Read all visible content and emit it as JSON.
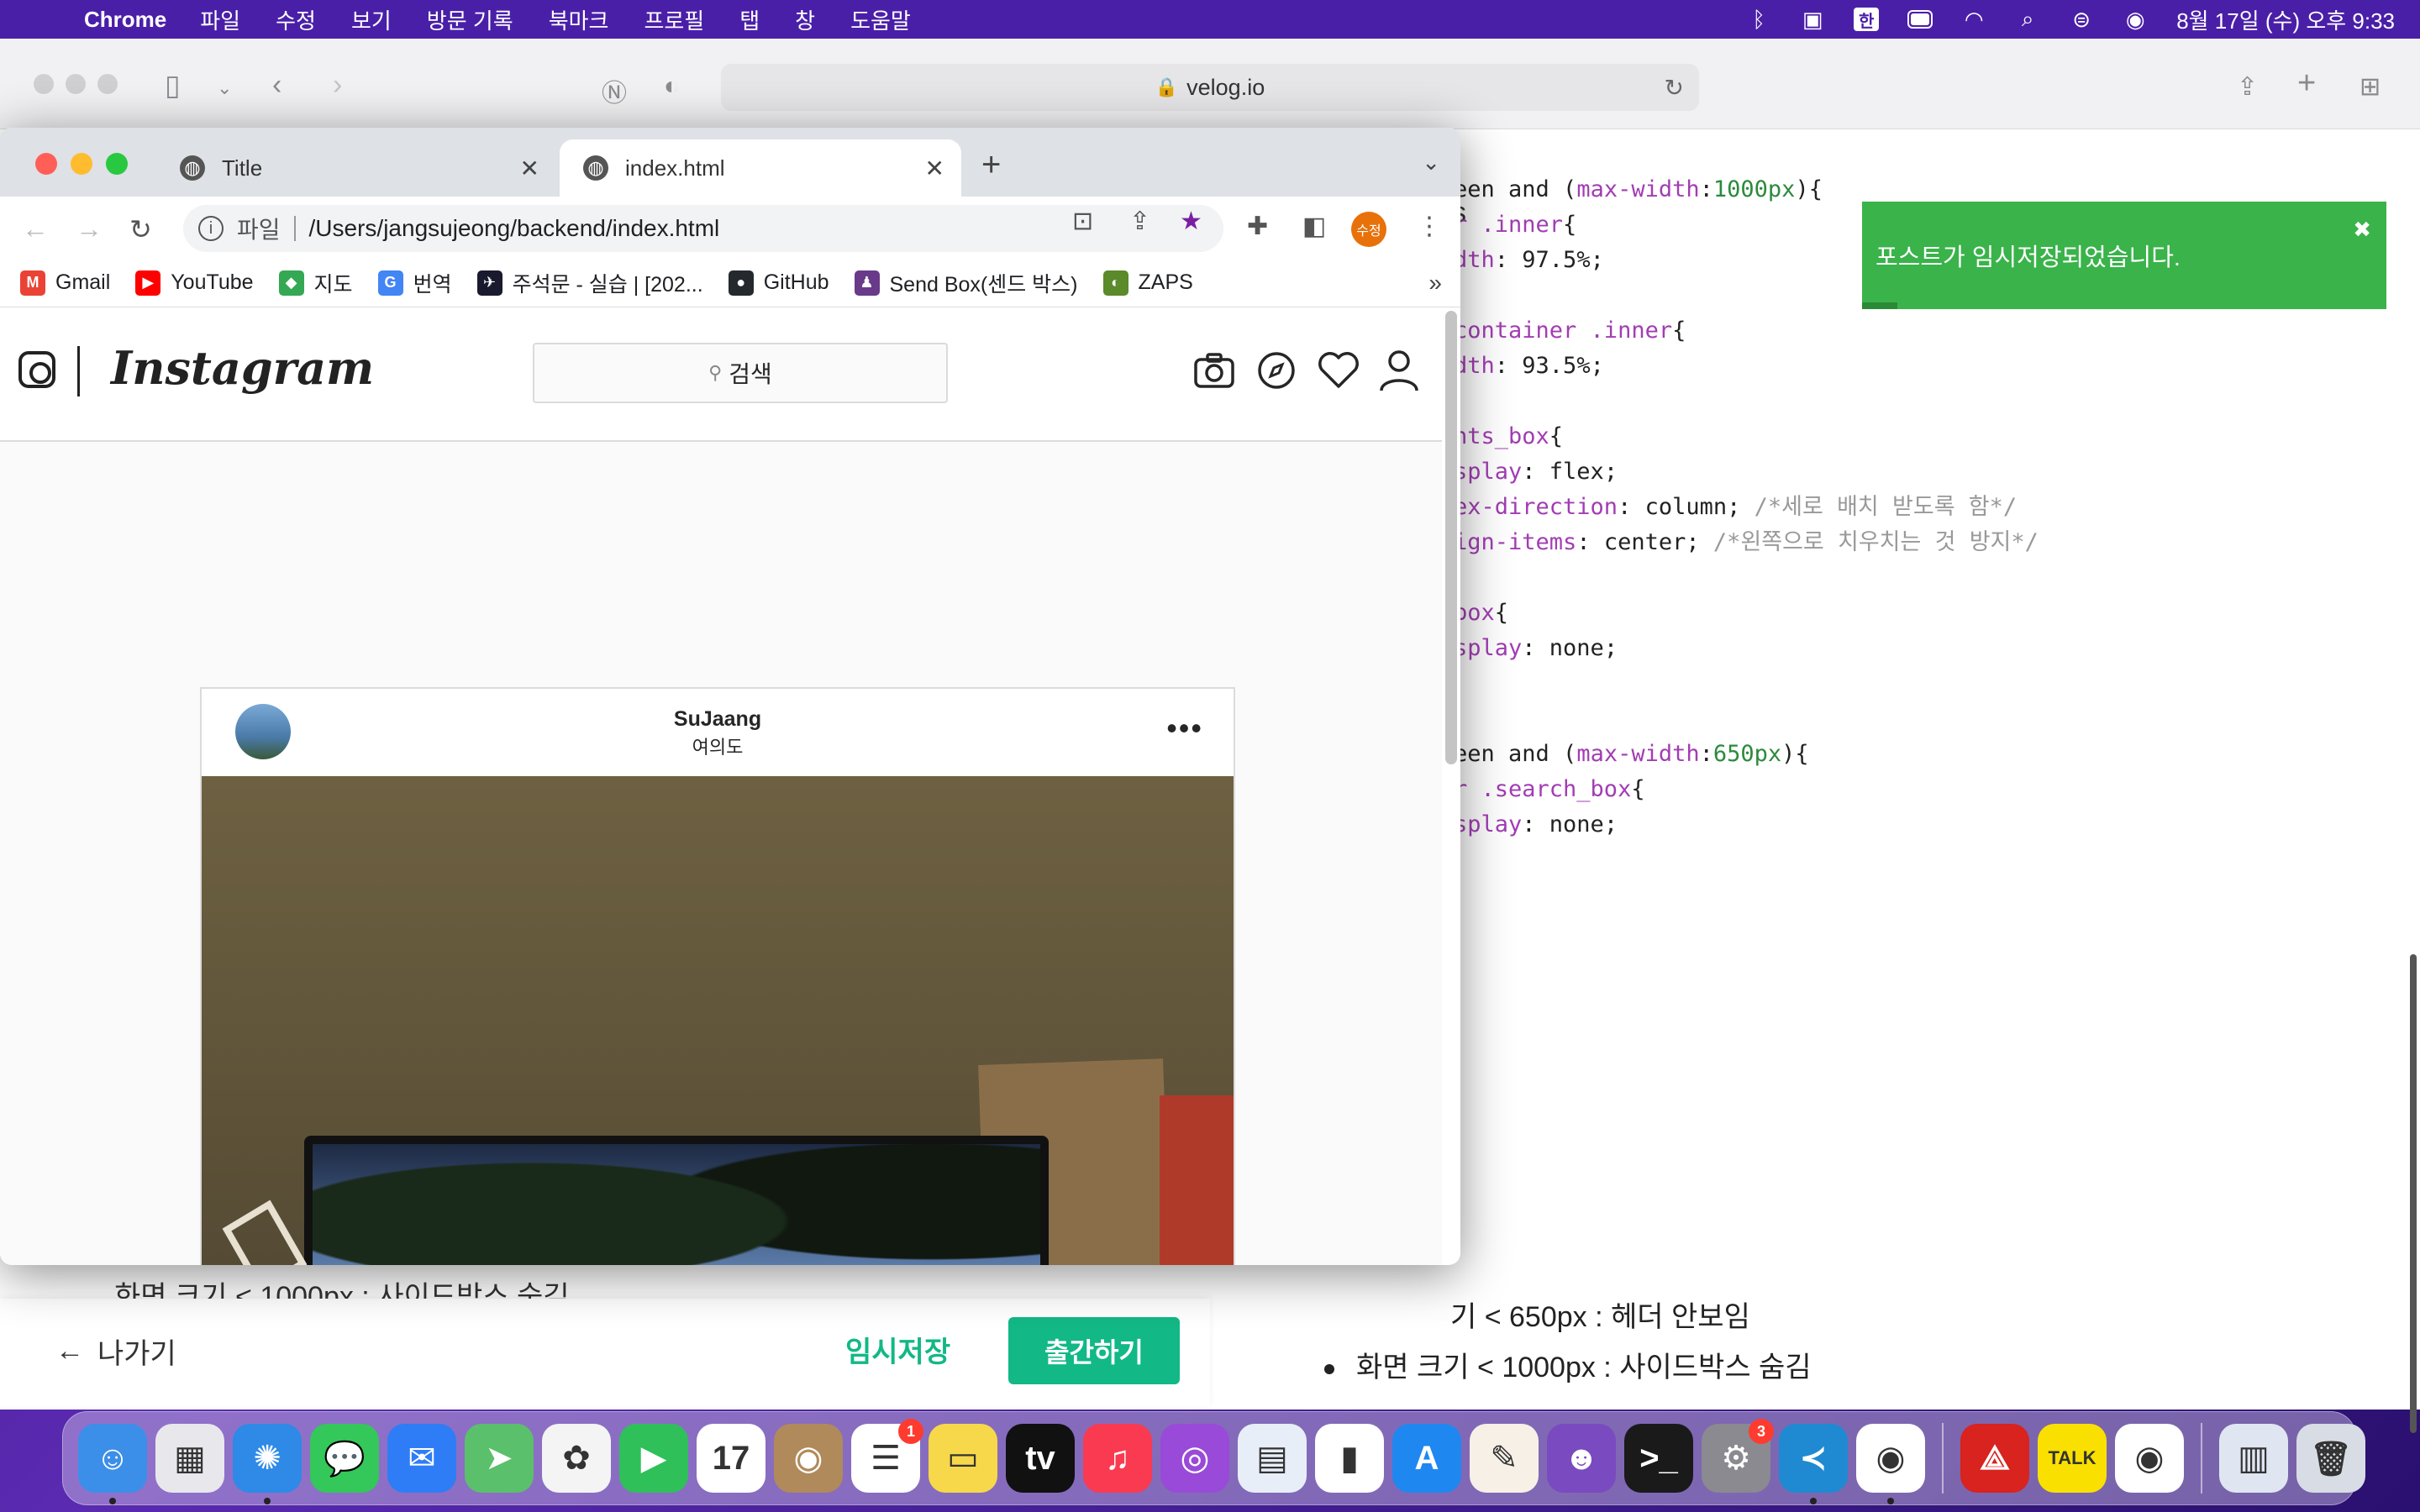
{
  "menubar": {
    "app_name": "Chrome",
    "menus": [
      "파일",
      "수정",
      "보기",
      "방문 기록",
      "북마크",
      "프로필",
      "탭",
      "창",
      "도움말"
    ],
    "ime_label": "한",
    "clock": "8월 17일 (수) 오후 9:33"
  },
  "safari": {
    "address": "velog.io",
    "section_letter": "s",
    "code_lines": [
      {
        "pre": "een and (",
        "kw": "max-width",
        "mid": ":",
        "num": "1000px",
        "post": "){",
        "cmt": ""
      },
      {
        "pre": "",
        "kw": "r .inner",
        "mid": "{",
        "num": "",
        "post": "",
        "cmt": ""
      },
      {
        "pre": "",
        "kw": "dth",
        "mid": ": 97.5%;",
        "num": "",
        "post": "",
        "cmt": ""
      },
      {
        "pre": "",
        "kw": "container .inner",
        "mid": "{",
        "num": "",
        "post": "",
        "cmt": ""
      },
      {
        "pre": "",
        "kw": "dth",
        "mid": ": 93.5%;",
        "num": "",
        "post": "",
        "cmt": ""
      },
      {
        "pre": "",
        "kw": "nts_box",
        "mid": "{",
        "num": "",
        "post": "",
        "cmt": ""
      },
      {
        "pre": "",
        "kw": "splay",
        "mid": ": flex;",
        "num": "",
        "post": "",
        "cmt": ""
      },
      {
        "pre": "",
        "kw": "ex-direction",
        "mid": ": column; ",
        "num": "",
        "post": "",
        "cmt": "/*세로 배치 받도록 함*/"
      },
      {
        "pre": "",
        "kw": "ign-items",
        "mid": ": center; ",
        "num": "",
        "post": "",
        "cmt": "/*왼쪽으로 치우치는 것 방지*/"
      },
      {
        "pre": "",
        "kw": "box",
        "mid": "{",
        "num": "",
        "post": "",
        "cmt": ""
      },
      {
        "pre": "",
        "kw": "splay",
        "mid": ": none;",
        "num": "",
        "post": "",
        "cmt": ""
      },
      {
        "pre": "een and (",
        "kw": "max-width",
        "mid": ":",
        "num": "650px",
        "post": "){",
        "cmt": ""
      },
      {
        "pre": "",
        "kw": "r .search_box",
        "mid": "{",
        "num": "",
        "post": "",
        "cmt": ""
      },
      {
        "pre": "",
        "kw": "splay",
        "mid": ": none;",
        "num": "",
        "post": "",
        "cmt": ""
      }
    ],
    "bullets": [
      "기 < 650px : 헤더 안보임",
      "화면 크기 < 1000px : 사이드박스 숨김"
    ],
    "toast": "포스트가 임시저장되었습니다.",
    "bottom_partial_text": "화면 크기 < 1000px : 사이드박스 숨김",
    "exit_label": "나가기",
    "temp_save_label": "임시저장",
    "publish_label": "출간하기"
  },
  "chrome": {
    "tabs": [
      {
        "title": "Title"
      },
      {
        "title": "index.html"
      }
    ],
    "omnibox_scheme": "파일",
    "omnibox_path": "/Users/jangsujeong/backend/index.html",
    "profile_label": "수정",
    "bookmarks": [
      {
        "label": "Gmail",
        "color": "#ea4335",
        "glyph": "M"
      },
      {
        "label": "YouTube",
        "color": "#ff0000",
        "glyph": "▶"
      },
      {
        "label": "지도",
        "color": "#34a853",
        "glyph": "◆"
      },
      {
        "label": "번역",
        "color": "#4285f4",
        "glyph": "G"
      },
      {
        "label": "주석문 - 실습 | [202...",
        "color": "#1a1a2e",
        "glyph": "✈"
      },
      {
        "label": "GitHub",
        "color": "#24292e",
        "glyph": "●"
      },
      {
        "label": "Send Box(센드 박스)",
        "color": "#6a3a8a",
        "glyph": "♟"
      },
      {
        "label": "ZAPS",
        "color": "#5a8a2a",
        "glyph": "◐"
      }
    ]
  },
  "instagram": {
    "wordmark": "Instagram",
    "search_placeholder": "검색",
    "post_user": "SuJaang",
    "post_location": "여의도",
    "more_glyph": "•••"
  },
  "dock": {
    "apps": [
      {
        "name": "finder",
        "color": "#3b8fe8",
        "glyph": "☺",
        "badge": "",
        "running": true
      },
      {
        "name": "launchpad",
        "color": "#e8e8ec",
        "glyph": "▦",
        "badge": "",
        "running": false
      },
      {
        "name": "safari",
        "color": "#2e8ae6",
        "glyph": "✺",
        "badge": "",
        "running": true
      },
      {
        "name": "messages",
        "color": "#34c759",
        "glyph": "💬",
        "badge": "",
        "running": false
      },
      {
        "name": "mail",
        "color": "#2f7df6",
        "glyph": "✉",
        "badge": "",
        "running": false
      },
      {
        "name": "maps",
        "color": "#5bc06c",
        "glyph": "➤",
        "badge": "",
        "running": false
      },
      {
        "name": "photos",
        "color": "#f4f4f4",
        "glyph": "✿",
        "badge": "",
        "running": false
      },
      {
        "name": "facetime",
        "color": "#2fc05a",
        "glyph": "▶",
        "badge": "",
        "running": false
      },
      {
        "name": "calendar",
        "color": "#ffffff",
        "glyph": "17",
        "badge": "",
        "running": false
      },
      {
        "name": "contacts",
        "color": "#b08a5a",
        "glyph": "◉",
        "badge": "",
        "running": false
      },
      {
        "name": "reminders",
        "color": "#ffffff",
        "glyph": "☰",
        "badge": "1",
        "running": false
      },
      {
        "name": "notes",
        "color": "#f7d84a",
        "glyph": "▭",
        "badge": "",
        "running": false
      },
      {
        "name": "apple-tv",
        "color": "#111111",
        "glyph": "tv",
        "badge": "",
        "running": false
      },
      {
        "name": "music",
        "color": "#fa3a50",
        "glyph": "♫",
        "badge": "",
        "running": false
      },
      {
        "name": "podcasts",
        "color": "#9a4ad8",
        "glyph": "◎",
        "badge": "",
        "running": false
      },
      {
        "name": "keynote",
        "color": "#e8eef8",
        "glyph": "▤",
        "badge": "",
        "running": false
      },
      {
        "name": "numbers",
        "color": "#ffffff",
        "glyph": "▮",
        "badge": "",
        "running": false
      },
      {
        "name": "app-store",
        "color": "#1e88f0",
        "glyph": "A",
        "badge": "",
        "running": false
      },
      {
        "name": "pages",
        "color": "#f6f0e6",
        "glyph": "✎",
        "badge": "",
        "running": false
      },
      {
        "name": "github-desktop",
        "color": "#7a4ac0",
        "glyph": "☻",
        "badge": "",
        "running": false
      },
      {
        "name": "terminal",
        "color": "#1a1a1a",
        "glyph": ">_",
        "badge": "",
        "running": false
      },
      {
        "name": "system-preferences",
        "color": "#8a8a90",
        "glyph": "⚙",
        "badge": "3",
        "running": false
      },
      {
        "name": "vscode",
        "color": "#1f8ad2",
        "glyph": "≺",
        "badge": "",
        "running": true
      },
      {
        "name": "chrome",
        "color": "#ffffff",
        "glyph": "◉",
        "badge": "",
        "running": true
      },
      {
        "name": "acrobat",
        "color": "#d8231f",
        "glyph": "⟁",
        "badge": "",
        "running": false
      },
      {
        "name": "kakaotalk",
        "color": "#f9e000",
        "glyph": "TALK",
        "badge": "",
        "running": false
      },
      {
        "name": "chrome-2",
        "color": "#ffffff",
        "glyph": "◉",
        "badge": "",
        "running": false
      },
      {
        "name": "documents",
        "color": "#dfe6f2",
        "glyph": "▥",
        "badge": "",
        "running": false
      },
      {
        "name": "trash",
        "color": "#d8dce4",
        "glyph": "🗑",
        "badge": "",
        "running": false
      }
    ]
  }
}
